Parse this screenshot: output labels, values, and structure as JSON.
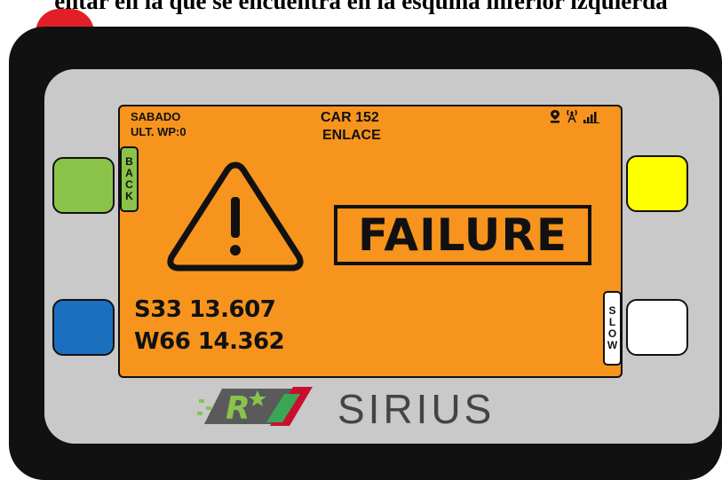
{
  "caption": "entar en la que se encuentra en la esquina inferior izquierda",
  "screen": {
    "day": "SABADO",
    "last_waypoint": "ULT. WP:0",
    "car": "CAR 152",
    "link": "ENLACE",
    "status": "FAILURE",
    "latitude": "S33 13.607",
    "longitude": "W66 14.362"
  },
  "tabs": {
    "back": [
      "B",
      "A",
      "C",
      "K"
    ],
    "slow": [
      "S",
      "L",
      "O",
      "W"
    ]
  },
  "brand": "SIRIUS",
  "icons": [
    "location-pin-icon",
    "antenna-icon",
    "signal-bars-icon",
    "warning-icon"
  ],
  "colors": {
    "screen": "#f7941d",
    "green_button": "#8bc34a",
    "blue_button": "#1a6fbf",
    "yellow_button": "#ffff00",
    "white_button": "#ffffff",
    "power_button": "#e21f26"
  }
}
